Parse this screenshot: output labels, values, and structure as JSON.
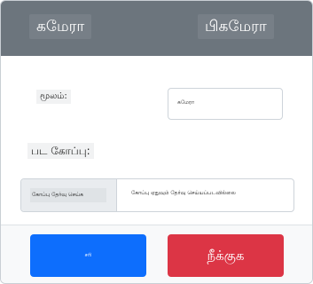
{
  "header": {
    "tabs": [
      {
        "label": "கமேரா"
      },
      {
        "label": "பிகமேரா"
      }
    ]
  },
  "form": {
    "source_label": "மூலம்:",
    "source_value": "கமேரா",
    "file_label": "பட கோப்பு:",
    "file_picker": {
      "button_label": "கோப்பு தேர்வு செய்க",
      "status_text": "கோப்பு ஏதுவும் தேர்வு செய்யப்படவில்லை"
    }
  },
  "footer": {
    "confirm_label": "சரி",
    "cancel_label": "நீக்குக"
  },
  "colors": {
    "header_bg": "#6c757d",
    "primary": "#0d6efd",
    "danger": "#dc3545"
  }
}
